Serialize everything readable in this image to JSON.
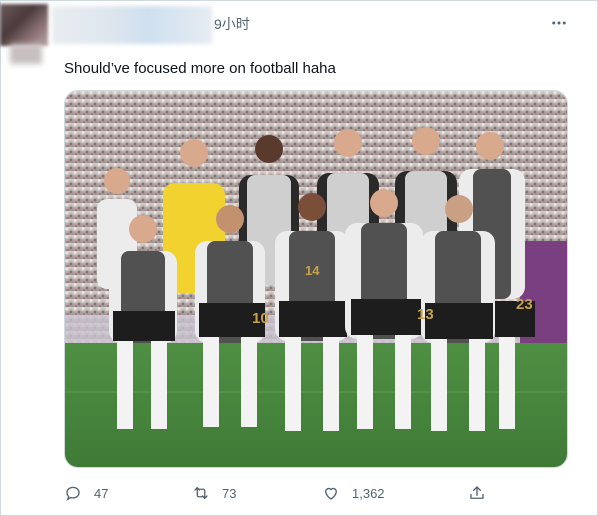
{
  "header": {
    "time": "9小时"
  },
  "tweet": {
    "text": "Should’ve focused more on football haha"
  },
  "photo": {
    "subject": "",
    "jersey_numbers": [
      "10",
      "14",
      "13",
      "23"
    ]
  },
  "actions": {
    "replies": "47",
    "retweets": "73",
    "likes": "1,362"
  },
  "icons": {
    "more": "more-icon",
    "reply": "reply-icon",
    "retweet": "retweet-icon",
    "like": "heart-icon",
    "share": "share-icon"
  },
  "colors": {
    "text": "#0f1419",
    "secondary": "#536471",
    "border": "#cfd9de"
  }
}
